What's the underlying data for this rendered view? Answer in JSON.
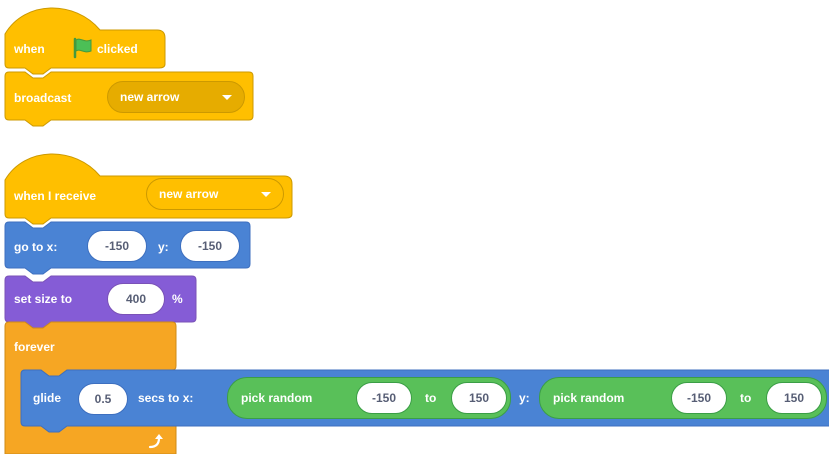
{
  "script1": {
    "hat_when": "when",
    "hat_clicked": "clicked",
    "broadcast_label": "broadcast",
    "broadcast_message": "new arrow"
  },
  "script2": {
    "hat_label": "when I receive",
    "hat_message": "new arrow",
    "goto": {
      "label_x": "go to x:",
      "x": "-150",
      "label_y": "y:",
      "y": "-150"
    },
    "setsize": {
      "label": "set size to",
      "value": "400",
      "unit": "%"
    },
    "forever_label": "forever",
    "glide": {
      "label": "glide",
      "secs": "0.5",
      "label_secs": "secs to x:",
      "rand_x": {
        "label": "pick random",
        "from": "-150",
        "to_label": "to",
        "to": "150"
      },
      "label_y": "y:",
      "rand_y": {
        "label": "pick random",
        "from": "-150",
        "to_label": "to",
        "to": "150"
      }
    }
  },
  "colors": {
    "events": "#ffbf00",
    "events_dark": "#e6ac00",
    "events_border": "#cc9900",
    "motion": "#4c97ff",
    "motion_block": "#4a83d4",
    "looks": "#9966ff",
    "looks_block": "#855cd6",
    "control": "#ffab19",
    "control_block": "#f6a623",
    "operators": "#59c059",
    "flag_green": "#4cbf56"
  },
  "icons": {
    "flag": "green-flag-icon",
    "loop_arrow": "loop-arrow-icon",
    "dropdown": "chevron-down-icon"
  }
}
